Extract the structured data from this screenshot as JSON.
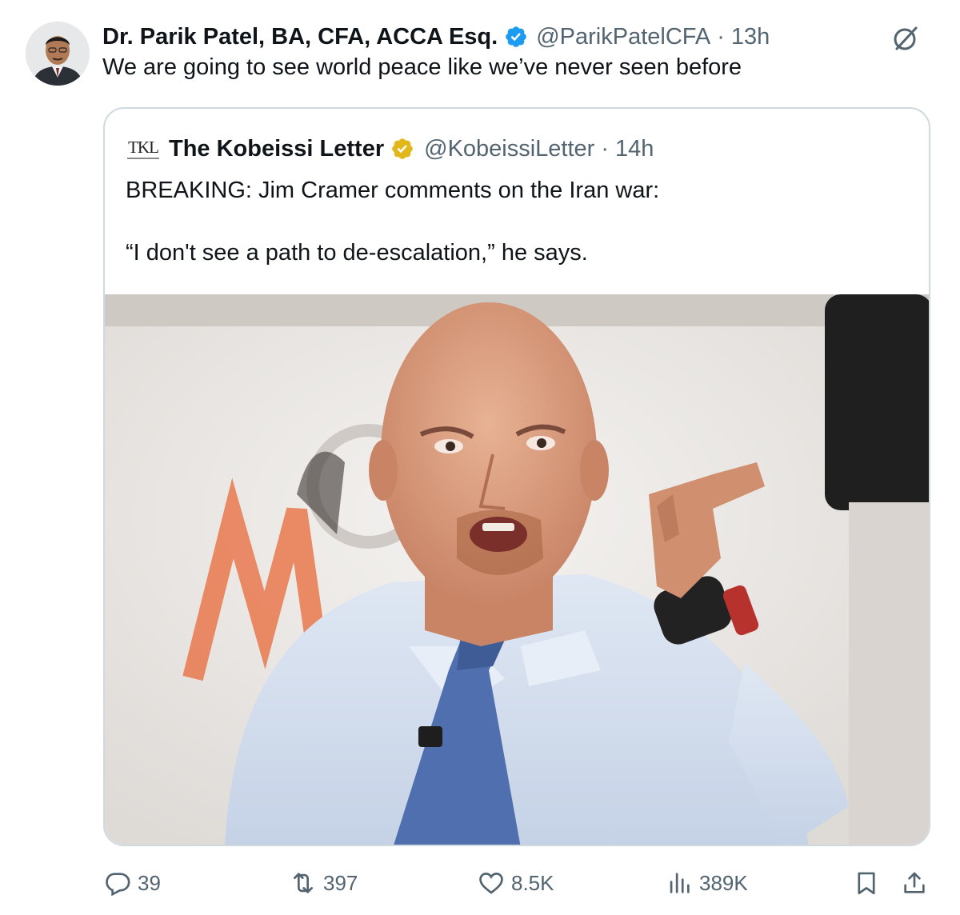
{
  "tweet": {
    "author_name": "Dr. Parik Patel, BA, CFA, ACCA Esq.",
    "author_handle": "@ParikPatelCFA",
    "separator": "·",
    "time": "13h",
    "text": "We are going to see world peace like we’ve never seen before"
  },
  "quote": {
    "avatar_text": "TKL",
    "author_name": "The Kobeissi Letter",
    "author_handle": "@KobeissiLetter",
    "separator": "·",
    "time": "14h",
    "line1": "BREAKING: Jim Cramer comments on the Iran war:",
    "line2": "“I don't see a path to de-escalation,” he says."
  },
  "actions": {
    "replies": "39",
    "reposts": "397",
    "likes": "8.5K",
    "views": "389K"
  },
  "icons": {
    "verified": "blue-verified-badge-icon",
    "verified_business": "gold-verified-badge-icon",
    "grok": "grok-icon",
    "reply": "reply-bubble-icon",
    "repost": "repost-arrows-icon",
    "like": "heart-icon",
    "views": "bar-chart-icon",
    "bookmark": "bookmark-icon",
    "share": "share-upload-icon"
  },
  "colors": {
    "text": "#0f1419",
    "secondary": "#536471",
    "verified_blue": "#1d9bf0",
    "verified_gold": "#e2b719",
    "border": "#cfd9de"
  }
}
